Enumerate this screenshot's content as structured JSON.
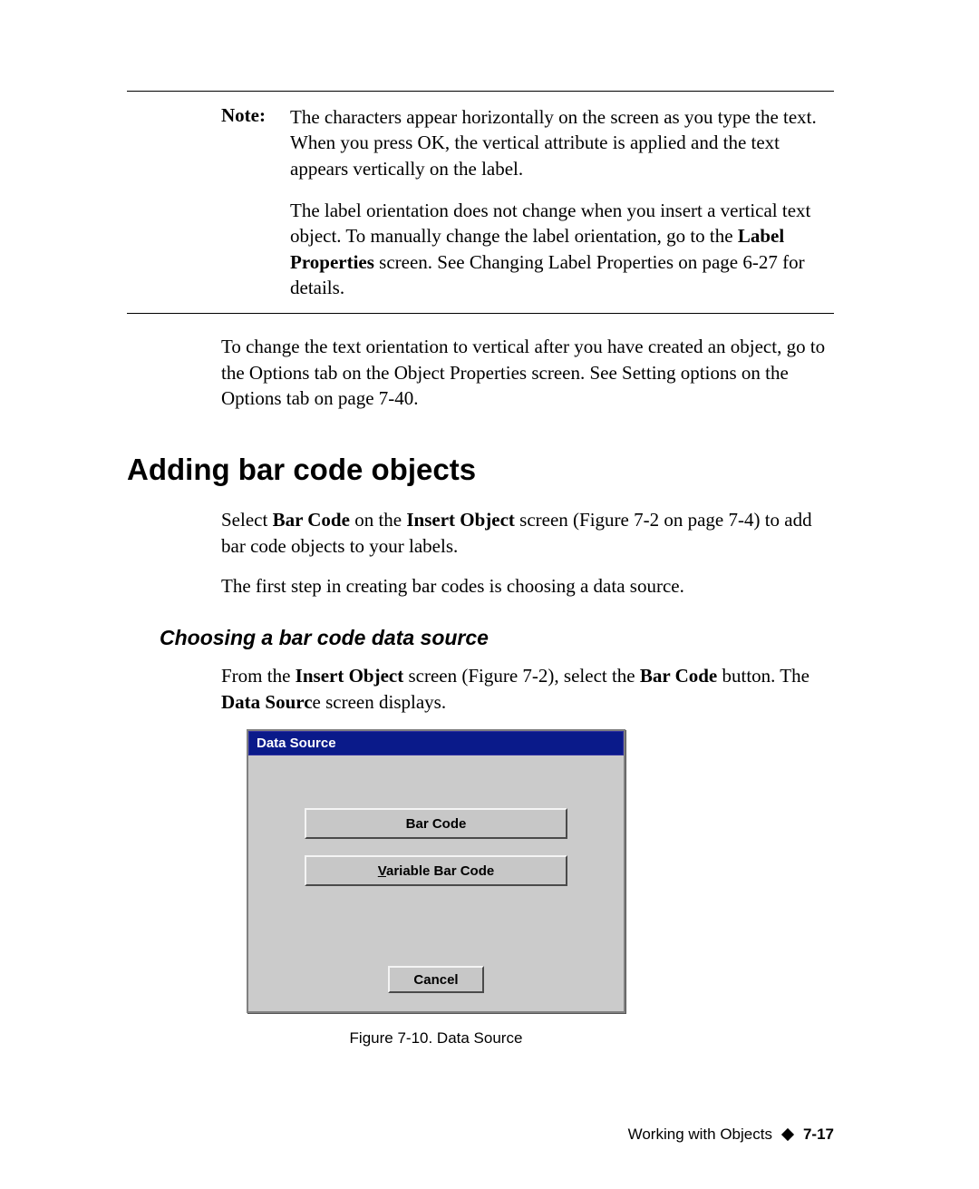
{
  "note": {
    "label": "Note:",
    "p1": "The characters appear horizontally on the screen as you type the text. When you press OK, the vertical attribute is applied and the text appears vertically on the label.",
    "p2a": "The label orientation does not change when you insert a vertical text object. To manually change the label orientation, go to the ",
    "p2b_bold": "Label Properties",
    "p2c": " screen. See Changing Label Properties on page 6-27 for details."
  },
  "after_note": "To change the text orientation to vertical after you have created an object, go to the Options tab on the Object Properties screen. See Setting options on the Options tab on page 7-40.",
  "h1": "Adding bar code objects",
  "p_add1a": "Select ",
  "p_add1b_bold": "Bar Code",
  "p_add1c": " on the ",
  "p_add1d_bold": "Insert Object",
  "p_add1e": " screen (Figure 7-2 on page 7-4) to add bar code objects to your labels.",
  "p_add2": "The first step in creating bar codes is choosing a data source.",
  "h2": "Choosing a bar code data source",
  "p_choose_a": "From the ",
  "p_choose_b_bold": "Insert Object",
  "p_choose_c": " screen (Figure 7-2), select the ",
  "p_choose_d_bold": "Bar Code",
  "p_choose_e": " button. The ",
  "p_choose_f_bold": "Data Sourc",
  "p_choose_g": "e screen displays.",
  "dialog": {
    "title": "Data Source",
    "barcode_btn": "Bar Code",
    "variable_btn_u": "V",
    "variable_btn_rest": "ariable Bar Code",
    "cancel_btn": "Cancel"
  },
  "figure_caption": "Figure 7-10. Data Source",
  "footer": {
    "text": "Working with Objects",
    "page": "7-17"
  }
}
